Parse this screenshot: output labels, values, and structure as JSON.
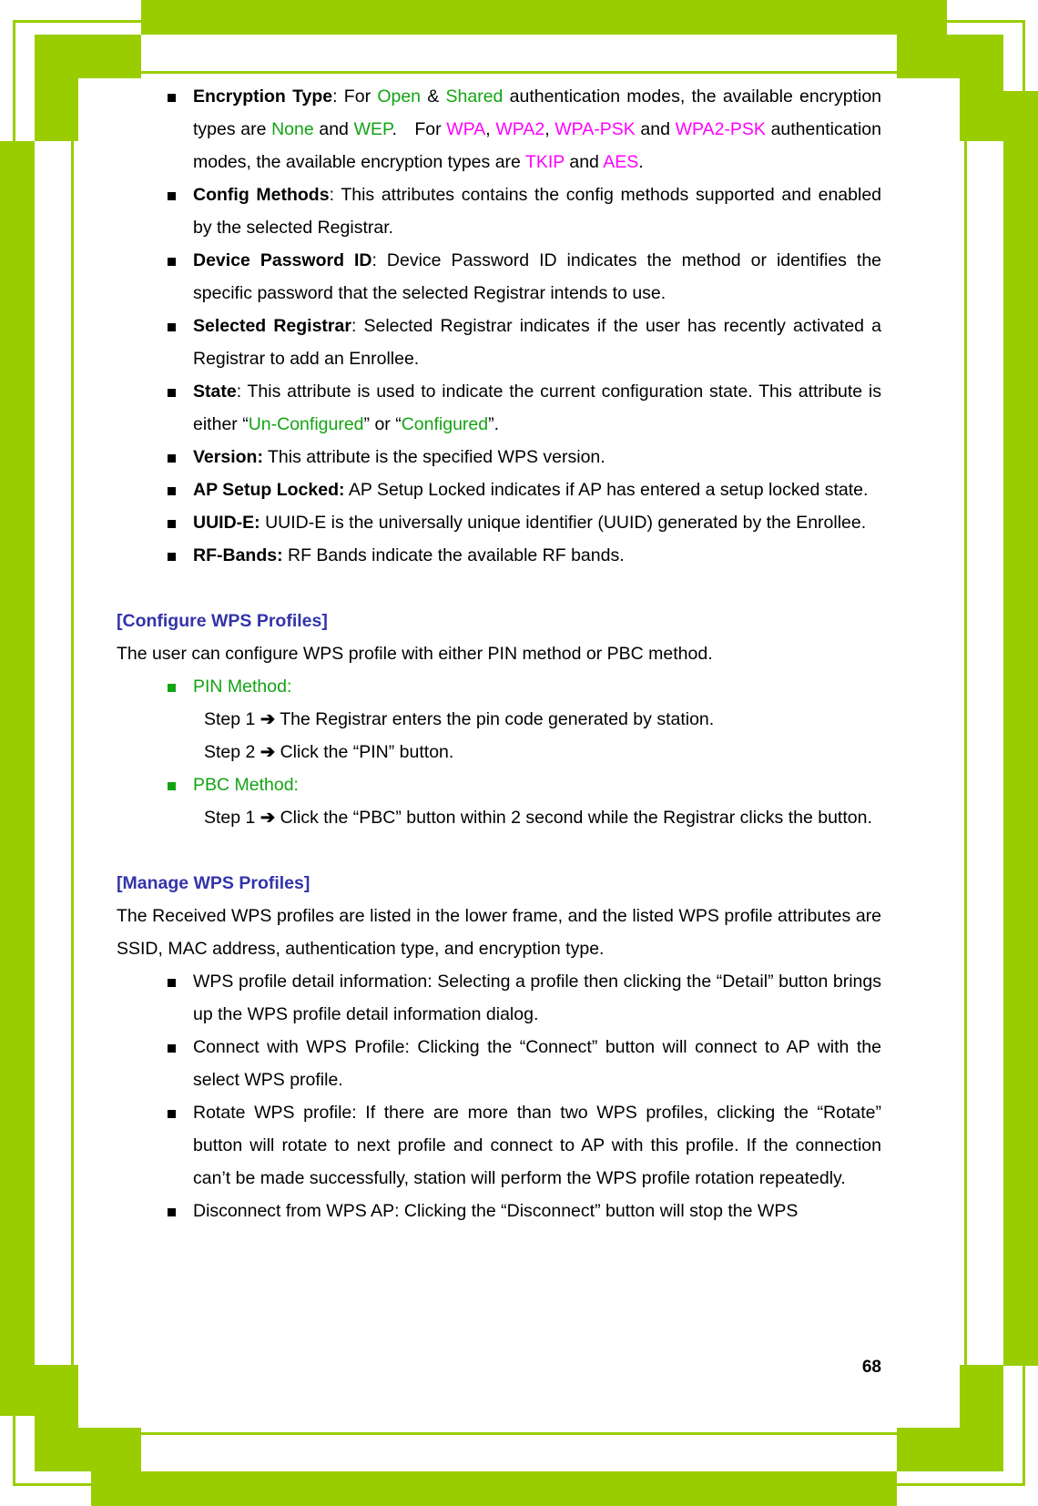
{
  "document": {
    "page_number": "68",
    "accent_green_border": "#9ACD00",
    "heading_color": "#3333AA",
    "green_text_color": "#13A413",
    "magenta_text_color": "#FF00FF"
  },
  "attributes_list": [
    {
      "term": "Encryption Type",
      "segments": [
        {
          "text": ": For ",
          "style": "plain"
        },
        {
          "text": "Open",
          "style": "green"
        },
        {
          "text": " & ",
          "style": "plain"
        },
        {
          "text": "Shared",
          "style": "green"
        },
        {
          "text": " authentication modes, the available encryption types are ",
          "style": "plain"
        },
        {
          "text": "None",
          "style": "green"
        },
        {
          "text": " and ",
          "style": "plain"
        },
        {
          "text": "WEP",
          "style": "green"
        },
        {
          "text": ". For ",
          "style": "plain"
        },
        {
          "text": "WPA",
          "style": "magenta"
        },
        {
          "text": ", ",
          "style": "plain"
        },
        {
          "text": "WPA2",
          "style": "magenta"
        },
        {
          "text": ", ",
          "style": "plain"
        },
        {
          "text": "WPA-PSK",
          "style": "magenta"
        },
        {
          "text": " and ",
          "style": "plain"
        },
        {
          "text": "WPA2-PSK",
          "style": "magenta"
        },
        {
          "text": " authentication modes, the available encryption types are ",
          "style": "plain"
        },
        {
          "text": "TKIP",
          "style": "magenta"
        },
        {
          "text": " and ",
          "style": "plain"
        },
        {
          "text": "AES",
          "style": "magenta"
        },
        {
          "text": ".",
          "style": "plain"
        }
      ]
    },
    {
      "term": "Config Methods",
      "segments": [
        {
          "text": ": This attributes contains the config methods supported and enabled by the selected Registrar.",
          "style": "plain"
        }
      ]
    },
    {
      "term": "Device Password ID",
      "segments": [
        {
          "text": ": Device Password ID indicates the method or identifies the specific password that the selected Registrar intends to use.",
          "style": "plain"
        }
      ]
    },
    {
      "term": "Selected Registrar",
      "segments": [
        {
          "text": ": Selected Registrar indicates if the user has recently activated a Registrar to add an Enrollee.",
          "style": "plain"
        }
      ]
    },
    {
      "term": "State",
      "segments": [
        {
          "text": ": This attribute is used to indicate the current configuration state. This attribute is either “",
          "style": "plain"
        },
        {
          "text": "Un-Configured",
          "style": "green"
        },
        {
          "text": "” or “",
          "style": "plain"
        },
        {
          "text": "Configured",
          "style": "green"
        },
        {
          "text": "”.",
          "style": "plain"
        }
      ]
    },
    {
      "term": "Version:",
      "segments": [
        {
          "text": " This attribute is the specified WPS version.",
          "style": "plain"
        }
      ]
    },
    {
      "term": "AP Setup Locked:",
      "segments": [
        {
          "text": " AP Setup Locked indicates if AP has entered a setup locked state.",
          "style": "plain"
        }
      ]
    },
    {
      "term": "UUID-E:",
      "segments": [
        {
          "text": " UUID-E is the universally unique identifier (UUID) generated by the Enrollee.",
          "style": "plain"
        }
      ]
    },
    {
      "term": "RF-Bands:",
      "segments": [
        {
          "text": " RF Bands indicate the available RF bands.",
          "style": "plain"
        }
      ]
    }
  ],
  "configure_section": {
    "heading": "[Configure WPS Profiles]",
    "intro": "The user can configure WPS profile with either PIN method or PBC method.",
    "methods": [
      {
        "label": "PIN Method:",
        "steps": [
          {
            "name": "Step 1",
            "arrow": "➔",
            "text": "The Registrar enters the pin code generated by station."
          },
          {
            "name": "Step 2",
            "arrow": "➔",
            "text": "Click the “PIN” button."
          }
        ]
      },
      {
        "label": "PBC Method:",
        "steps": [
          {
            "name": "Step 1",
            "arrow": "➔",
            "text": "Click the “PBC” button within 2 second while the Registrar clicks the button."
          }
        ]
      }
    ]
  },
  "manage_section": {
    "heading": "[Manage WPS Profiles]",
    "intro": "The Received WPS profiles are listed in the lower frame, and the listed WPS profile attributes are SSID, MAC address, authentication type, and encryption type.",
    "items": [
      "WPS profile detail information: Selecting a profile then clicking the “Detail” button brings up the WPS profile detail information dialog.",
      "Connect with WPS Profile: Clicking the “Connect” button will connect to AP with the select WPS profile.",
      "Rotate WPS profile: If there are more than two WPS profiles, clicking the “Rotate” button will rotate to next profile and connect to AP with this profile. If the connection can’t be made successfully, station will perform the WPS profile rotation repeatedly.",
      "Disconnect from WPS AP: Clicking the “Disconnect” button will stop the WPS"
    ]
  }
}
